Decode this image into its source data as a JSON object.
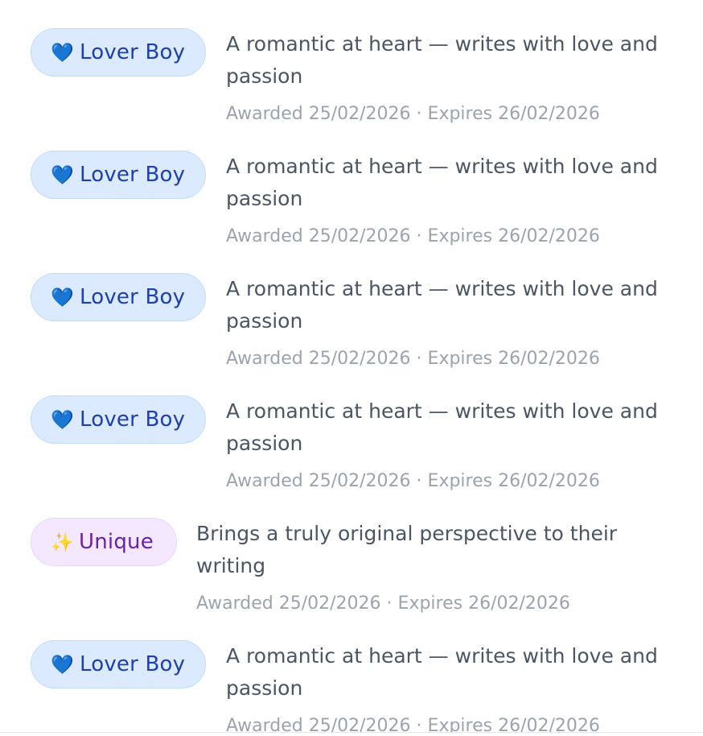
{
  "badges": [
    {
      "icon": "💙",
      "label": "Lover Boy",
      "description": "A romantic at heart — writes with love and passion",
      "awarded": "Awarded 25/02/2026",
      "expires": "Expires 26/02/2026"
    },
    {
      "icon": "💙",
      "label": "Lover Boy",
      "description": "A romantic at heart — writes with love and passion",
      "awarded": "Awarded 25/02/2026",
      "expires": "Expires 26/02/2026"
    },
    {
      "icon": "💙",
      "label": "Lover Boy",
      "description": "A romantic at heart — writes with love and passion",
      "awarded": "Awarded 25/02/2026",
      "expires": "Expires 26/02/2026"
    },
    {
      "icon": "💙",
      "label": "Lover Boy",
      "description": "A romantic at heart — writes with love and passion",
      "awarded": "Awarded 25/02/2026",
      "expires": "Expires 26/02/2026"
    },
    {
      "icon": "✨",
      "label": "Unique",
      "description": "Brings a truly original perspective to their writing",
      "awarded": "Awarded 25/02/2026",
      "expires": "Expires 26/02/2026"
    },
    {
      "icon": "💙",
      "label": "Lover Boy",
      "description": "A romantic at heart — writes with love and passion",
      "awarded": "Awarded 25/02/2026",
      "expires": "Expires 26/02/2026"
    }
  ],
  "meta_separator": " · ",
  "colors": {
    "lover_pill_bg": "#dbeafe",
    "lover_pill_text": "#1e40af",
    "unique_pill_bg": "#f3e8ff",
    "unique_pill_text": "#6b21a8",
    "description_text": "#4b5563",
    "meta_text": "#9ca3af"
  }
}
